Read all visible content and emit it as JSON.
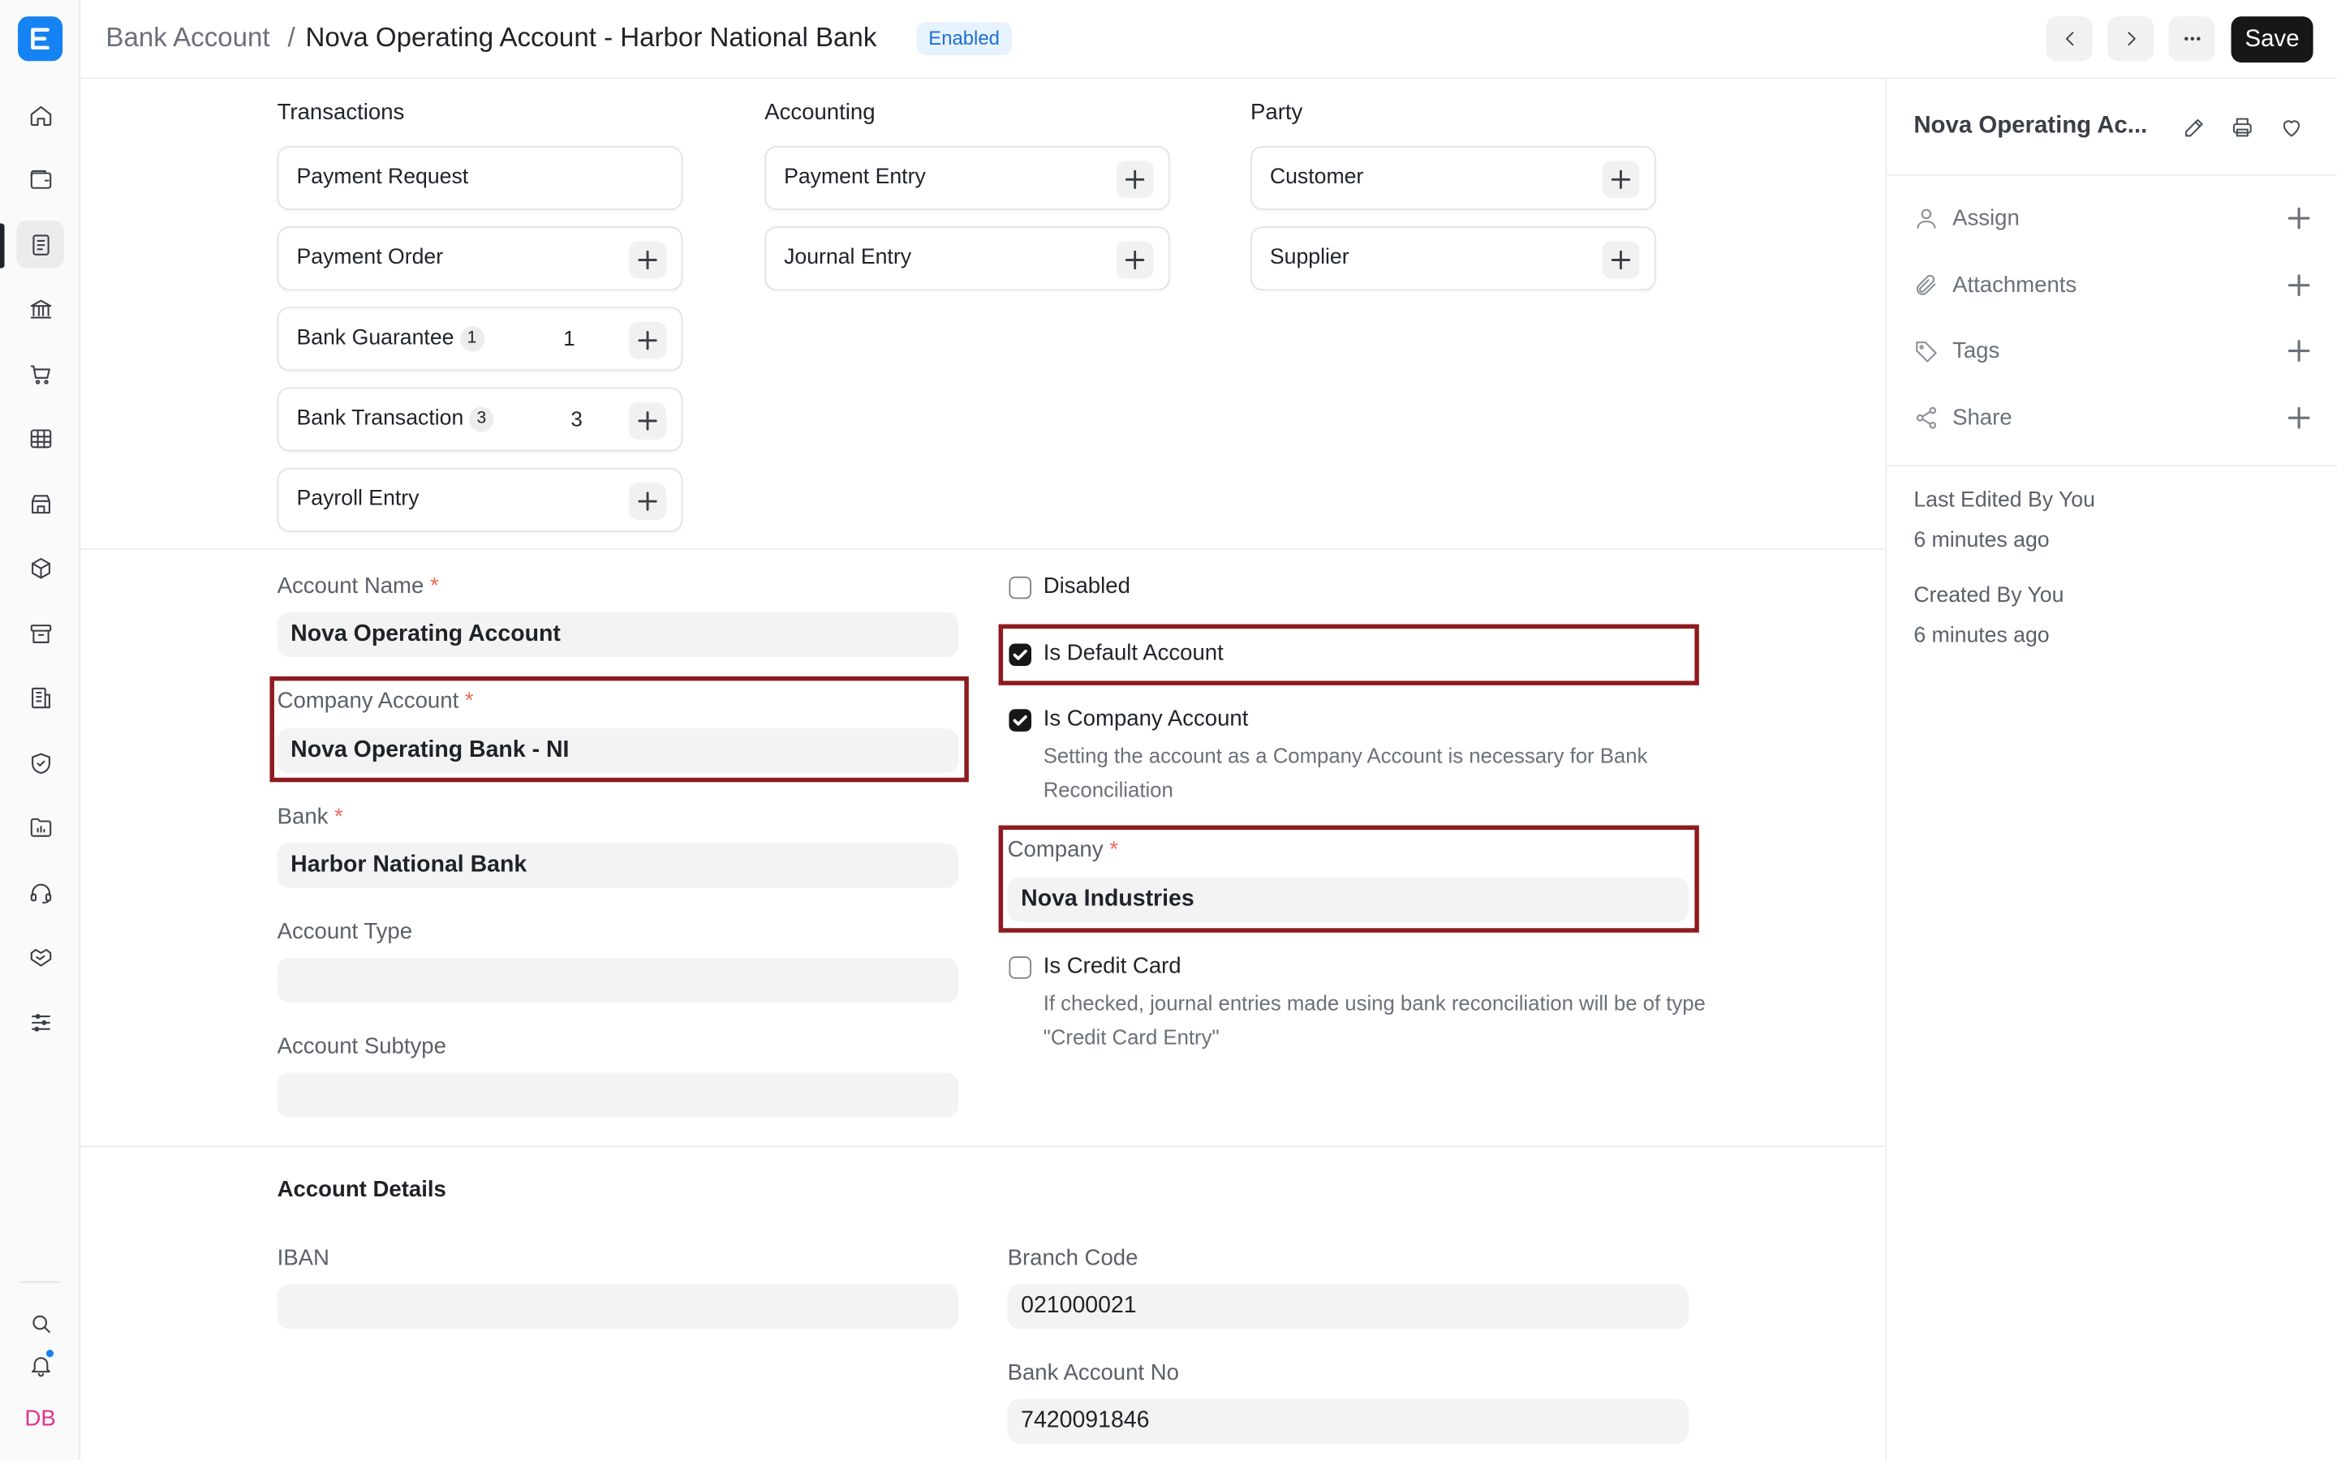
{
  "header": {
    "breadcrumb_parent": "Bank Account",
    "separator": "/",
    "title": "Nova Operating Account - Harbor National Bank",
    "status_badge": "Enabled",
    "save_label": "Save"
  },
  "connections": {
    "transactions": {
      "heading": "Transactions",
      "items": [
        {
          "label": "Payment Request"
        },
        {
          "label": "Payment Order"
        },
        {
          "label": "Bank Guarantee",
          "count": "1"
        },
        {
          "label": "Bank Transaction",
          "count": "3"
        },
        {
          "label": "Payroll Entry"
        }
      ]
    },
    "accounting": {
      "heading": "Accounting",
      "items": [
        {
          "label": "Payment Entry"
        },
        {
          "label": "Journal Entry"
        }
      ]
    },
    "party": {
      "heading": "Party",
      "items": [
        {
          "label": "Customer"
        },
        {
          "label": "Supplier"
        }
      ]
    }
  },
  "form": {
    "account_name": {
      "label": "Account Name",
      "required": "*",
      "value": "Nova Operating Account"
    },
    "company_account": {
      "label": "Company Account",
      "required": "*",
      "value": "Nova Operating Bank - NI"
    },
    "bank": {
      "label": "Bank",
      "required": "*",
      "value": "Harbor National Bank"
    },
    "account_type": {
      "label": "Account Type",
      "value": ""
    },
    "account_subtype": {
      "label": "Account Subtype",
      "value": ""
    },
    "disabled": {
      "label": "Disabled",
      "checked": false
    },
    "is_default": {
      "label": "Is Default Account",
      "checked": true
    },
    "is_company": {
      "label": "Is Company Account",
      "checked": true,
      "description": "Setting the account as a Company Account is necessary for Bank Reconciliation"
    },
    "company": {
      "label": "Company",
      "required": "*",
      "value": "Nova Industries"
    },
    "is_credit_card": {
      "label": "Is Credit Card",
      "checked": false,
      "description": "If checked, journal entries made using bank reconciliation will be of type \"Credit Card Entry\""
    }
  },
  "account_details": {
    "heading": "Account Details",
    "iban": {
      "label": "IBAN",
      "value": ""
    },
    "branch_code": {
      "label": "Branch Code",
      "value": "021000021"
    },
    "bank_account_no": {
      "label": "Bank Account No",
      "value": "7420091846"
    }
  },
  "sidebar": {
    "title": "Nova Operating Ac...",
    "actions": [
      {
        "label": "Assign",
        "icon": "user-icon"
      },
      {
        "label": "Attachments",
        "icon": "paperclip-icon"
      },
      {
        "label": "Tags",
        "icon": "tag-icon"
      },
      {
        "label": "Share",
        "icon": "share-icon"
      }
    ],
    "last_edited_label": "Last Edited By You",
    "last_edited_time": "6 minutes ago",
    "created_label": "Created By You",
    "created_time": "6 minutes ago"
  },
  "user": {
    "initials": "DB"
  },
  "colors": {
    "accent": "#1583f4",
    "highlight_border": "#8e1b1f",
    "save_button": "#171717",
    "badge_bg": "#e6f2fe",
    "avatar_text": "#e0338d"
  }
}
